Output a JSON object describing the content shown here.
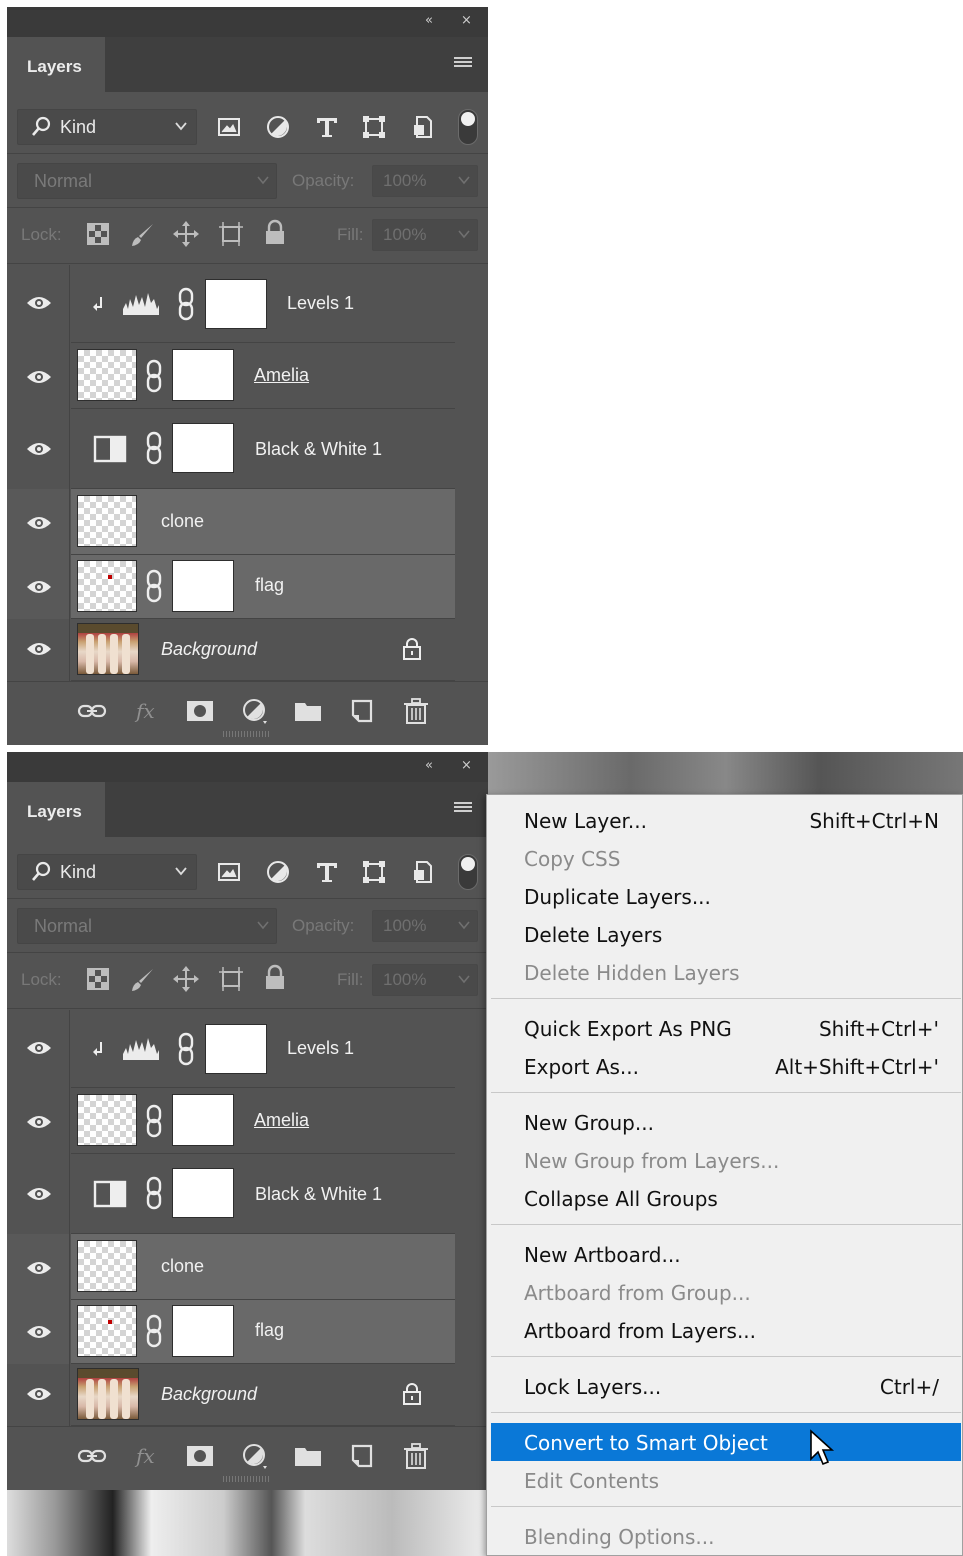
{
  "panel": {
    "tab_label": "Layers",
    "collapse_glyph": "«",
    "close_glyph": "×",
    "kind_label": "Kind",
    "blend_mode": "Normal",
    "opacity_label": "Opacity:",
    "opacity_value": "100%",
    "lock_label": "Lock:",
    "fill_label": "Fill:",
    "fill_value": "100%",
    "filter_icons": [
      "image-filter-icon",
      "adjustment-filter-icon",
      "type-filter-icon",
      "shape-filter-icon",
      "smart-object-filter-icon"
    ],
    "lock_icons": [
      "lock-transparent-icon",
      "lock-image-icon",
      "lock-position-icon",
      "lock-artboard-icon",
      "lock-all-icon"
    ],
    "footer_icons": [
      "link-layers-icon",
      "fx-icon",
      "add-mask-icon",
      "new-adjustment-icon",
      "new-group-icon",
      "new-layer-icon",
      "delete-layer-icon"
    ]
  },
  "layers": [
    {
      "name": "Levels 1",
      "type": "adjustment",
      "clipped": true,
      "selected": false
    },
    {
      "name": "Amelia",
      "type": "masked-pixel",
      "underline": true,
      "selected": false
    },
    {
      "name": "Black & White 1",
      "type": "adjustment",
      "selected": false
    },
    {
      "name": "clone",
      "type": "pixel",
      "selected": true
    },
    {
      "name": "flag",
      "type": "masked-pixel",
      "selected": true
    },
    {
      "name": "Background",
      "type": "background",
      "italic": true,
      "locked": true,
      "selected": false
    }
  ],
  "context_menu": {
    "items": [
      {
        "label": "New Layer...",
        "shortcut": "Shift+Ctrl+N",
        "enabled": true
      },
      {
        "label": "Copy CSS",
        "shortcut": "",
        "enabled": false
      },
      {
        "label": "Duplicate Layers...",
        "shortcut": "",
        "enabled": true
      },
      {
        "label": "Delete Layers",
        "shortcut": "",
        "enabled": true
      },
      {
        "label": "Delete Hidden Layers",
        "shortcut": "",
        "enabled": false
      },
      {
        "label": "Quick Export As PNG",
        "shortcut": "Shift+Ctrl+'",
        "enabled": true
      },
      {
        "label": "Export As...",
        "shortcut": "Alt+Shift+Ctrl+'",
        "enabled": true
      },
      {
        "label": "New Group...",
        "shortcut": "",
        "enabled": true
      },
      {
        "label": "New Group from Layers...",
        "shortcut": "",
        "enabled": false
      },
      {
        "label": "Collapse All Groups",
        "shortcut": "",
        "enabled": true
      },
      {
        "label": "New Artboard...",
        "shortcut": "",
        "enabled": true
      },
      {
        "label": "Artboard from Group...",
        "shortcut": "",
        "enabled": false
      },
      {
        "label": "Artboard from Layers...",
        "shortcut": "",
        "enabled": true
      },
      {
        "label": "Lock Layers...",
        "shortcut": "Ctrl+/",
        "enabled": true
      },
      {
        "label": "Convert to Smart Object",
        "shortcut": "",
        "enabled": true,
        "highlighted": true
      },
      {
        "label": "Edit Contents",
        "shortcut": "",
        "enabled": false
      },
      {
        "label": "Blending Options...",
        "shortcut": "",
        "enabled": false
      }
    ]
  },
  "colors": {
    "panel_bg": "#535353",
    "selected_row": "#696969",
    "menu_highlight": "#0a78d7"
  }
}
